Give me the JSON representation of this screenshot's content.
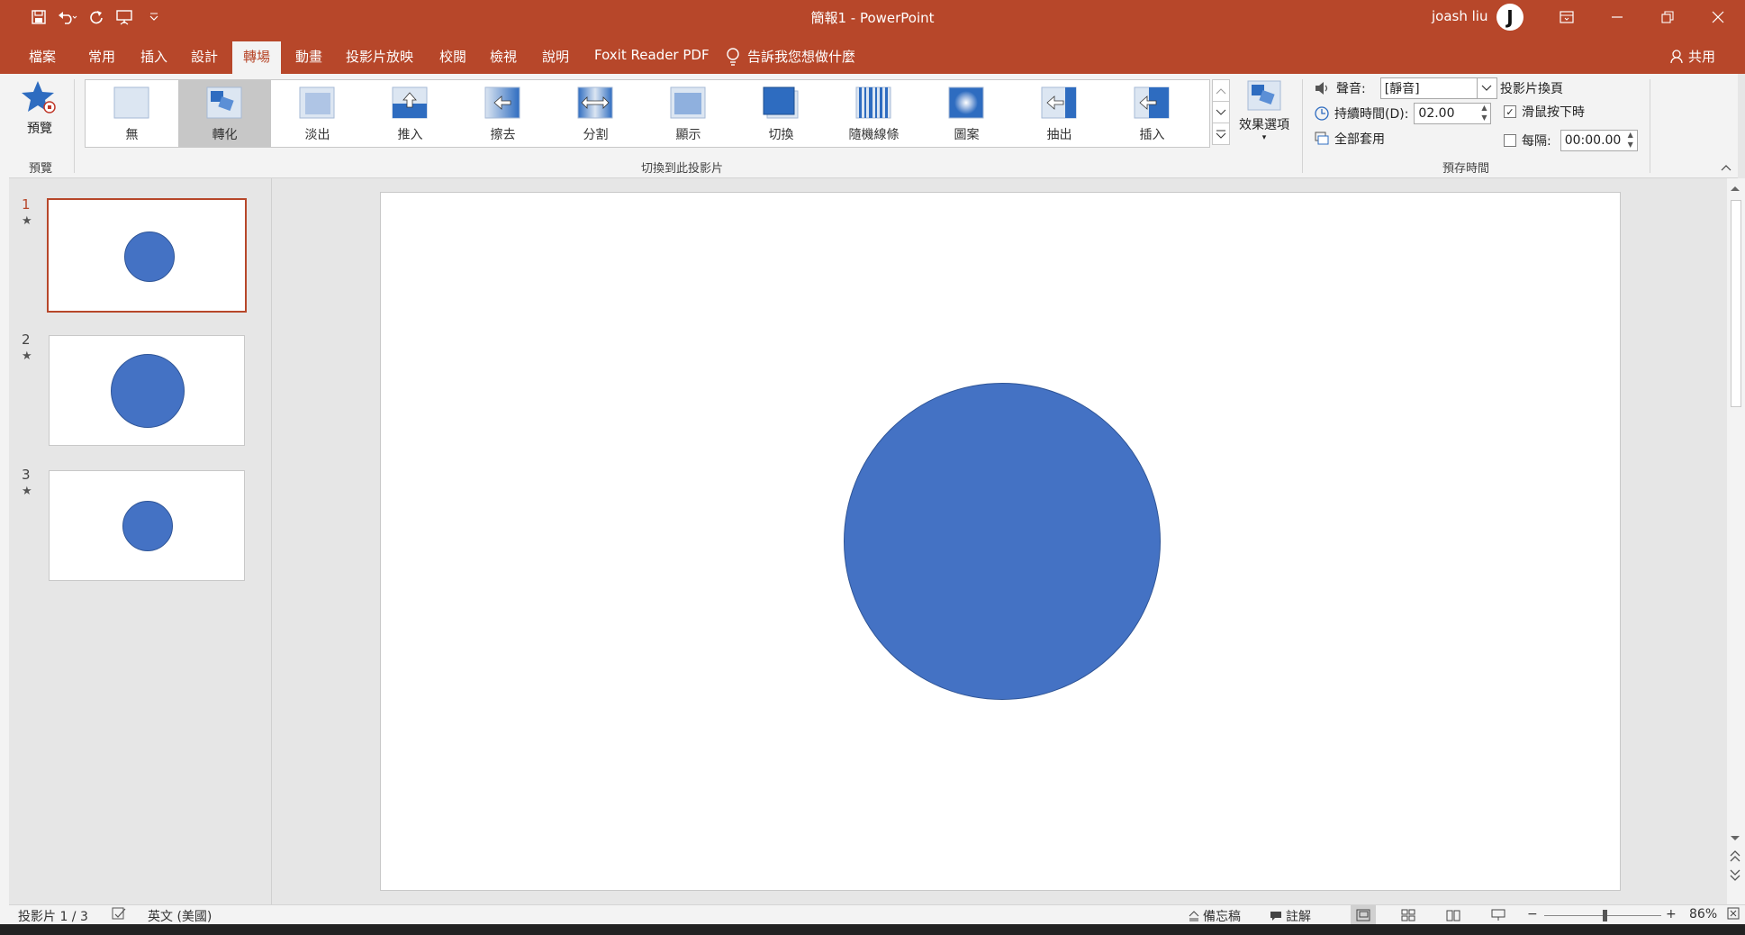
{
  "window": {
    "title": "簡報1  -  PowerPoint",
    "user_name": "joash liu",
    "avatar_initial": "J"
  },
  "tabs": [
    {
      "label": "檔案",
      "active": false
    },
    {
      "label": "常用",
      "active": false
    },
    {
      "label": "插入",
      "active": false
    },
    {
      "label": "設計",
      "active": false
    },
    {
      "label": "轉場",
      "active": true
    },
    {
      "label": "動畫",
      "active": false
    },
    {
      "label": "投影片放映",
      "active": false
    },
    {
      "label": "校閱",
      "active": false
    },
    {
      "label": "檢視",
      "active": false
    },
    {
      "label": "說明",
      "active": false
    },
    {
      "label": "Foxit Reader PDF",
      "active": false
    }
  ],
  "tell_me": "告訴我您想做什麼",
  "share": "共用",
  "ribbon": {
    "preview_label": "預覽",
    "preview_group": "預覽",
    "transitions_group": "切換到此投影片",
    "transitions": [
      {
        "label": "無",
        "icon": "none-transition-icon",
        "selected": false
      },
      {
        "label": "轉化",
        "icon": "morph-transition-icon",
        "selected": true
      },
      {
        "label": "淡出",
        "icon": "fade-transition-icon",
        "selected": false
      },
      {
        "label": "推入",
        "icon": "push-transition-icon",
        "selected": false
      },
      {
        "label": "擦去",
        "icon": "wipe-transition-icon",
        "selected": false
      },
      {
        "label": "分割",
        "icon": "split-transition-icon",
        "selected": false
      },
      {
        "label": "顯示",
        "icon": "reveal-transition-icon",
        "selected": false
      },
      {
        "label": "切換",
        "icon": "cut-transition-icon",
        "selected": false
      },
      {
        "label": "隨機線條",
        "icon": "random-bars-transition-icon",
        "selected": false
      },
      {
        "label": "圖案",
        "icon": "shape-transition-icon",
        "selected": false
      },
      {
        "label": "抽出",
        "icon": "uncover-transition-icon",
        "selected": false
      },
      {
        "label": "插入",
        "icon": "cover-transition-icon",
        "selected": false
      }
    ],
    "effect_options": "效果選項",
    "timing_group": "預存時間",
    "sound_label": "聲音:",
    "sound_value": "[靜音]",
    "duration_label": "持續時間(D):",
    "duration_value": "02.00",
    "apply_all": "全部套用",
    "advance_title": "投影片換頁",
    "on_click_label": "滑鼠按下時",
    "on_click_checked": true,
    "after_label": "每隔:",
    "after_checked": false,
    "after_value": "00:00.00"
  },
  "slides": [
    {
      "number": "1",
      "selected": true
    },
    {
      "number": "2",
      "selected": false
    },
    {
      "number": "3",
      "selected": false
    }
  ],
  "statusbar": {
    "slide_info": "投影片 1 / 3",
    "language": "英文 (美國)",
    "notes": "備忘稿",
    "comments": "註解",
    "zoom": "86%"
  },
  "colors": {
    "accent": "#b7472a",
    "shape_fill": "#4472c4",
    "shape_border": "#2f5597"
  }
}
